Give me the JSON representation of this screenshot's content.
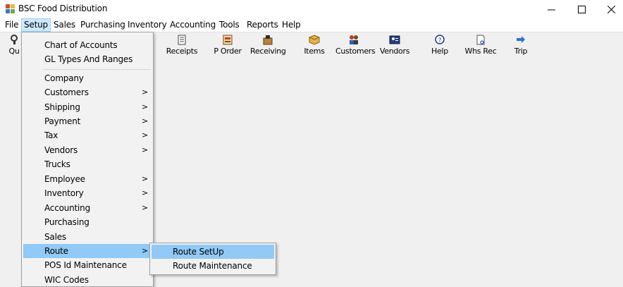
{
  "window": {
    "title": "BSC Food Distribution"
  },
  "menubar": {
    "items": [
      "File",
      "Setup",
      "Sales",
      "Purchasing",
      "Inventory",
      "Accounting",
      "Tools",
      "Reports",
      "Help"
    ]
  },
  "toolbar": {
    "partial_label": "Qu",
    "buttons": [
      {
        "label": "Receipts",
        "icon": "receipts-icon"
      },
      {
        "label": "P Order",
        "icon": "purchase-order-icon"
      },
      {
        "label": "Receiving",
        "icon": "receiving-icon"
      },
      {
        "label": "Items",
        "icon": "items-icon"
      },
      {
        "label": "Customers",
        "icon": "customers-icon"
      },
      {
        "label": "Vendors",
        "icon": "vendors-icon"
      },
      {
        "label": "Help",
        "icon": "help-icon"
      },
      {
        "label": "Whs Rec",
        "icon": "warehouse-receiving-icon"
      },
      {
        "label": "Trip",
        "icon": "trip-icon"
      }
    ]
  },
  "setup_menu": {
    "items": [
      {
        "label": "Chart of Accounts",
        "submenu": false
      },
      {
        "label": "GL Types And Ranges",
        "submenu": false
      },
      {
        "label": "Company",
        "submenu": false
      },
      {
        "label": "Customers",
        "submenu": true
      },
      {
        "label": "Shipping",
        "submenu": true
      },
      {
        "label": "Payment",
        "submenu": true
      },
      {
        "label": "Tax",
        "submenu": true
      },
      {
        "label": "Vendors",
        "submenu": true
      },
      {
        "label": "Trucks",
        "submenu": false
      },
      {
        "label": "Employee",
        "submenu": true
      },
      {
        "label": "Inventory",
        "submenu": true
      },
      {
        "label": "Accounting",
        "submenu": true
      },
      {
        "label": "Purchasing",
        "submenu": false
      },
      {
        "label": "Sales",
        "submenu": false
      },
      {
        "label": "Route",
        "submenu": true,
        "highlighted": true
      },
      {
        "label": "POS Id Maintenance",
        "submenu": false
      },
      {
        "label": "WIC Codes",
        "submenu": false
      }
    ],
    "arrow_glyph": ">"
  },
  "route_submenu": {
    "items": [
      {
        "label": "Route SetUp",
        "highlighted": true
      },
      {
        "label": "Route Maintenance"
      }
    ]
  },
  "colors": {
    "highlight": "#91c9f7",
    "active_menu": "#cce8ff"
  }
}
